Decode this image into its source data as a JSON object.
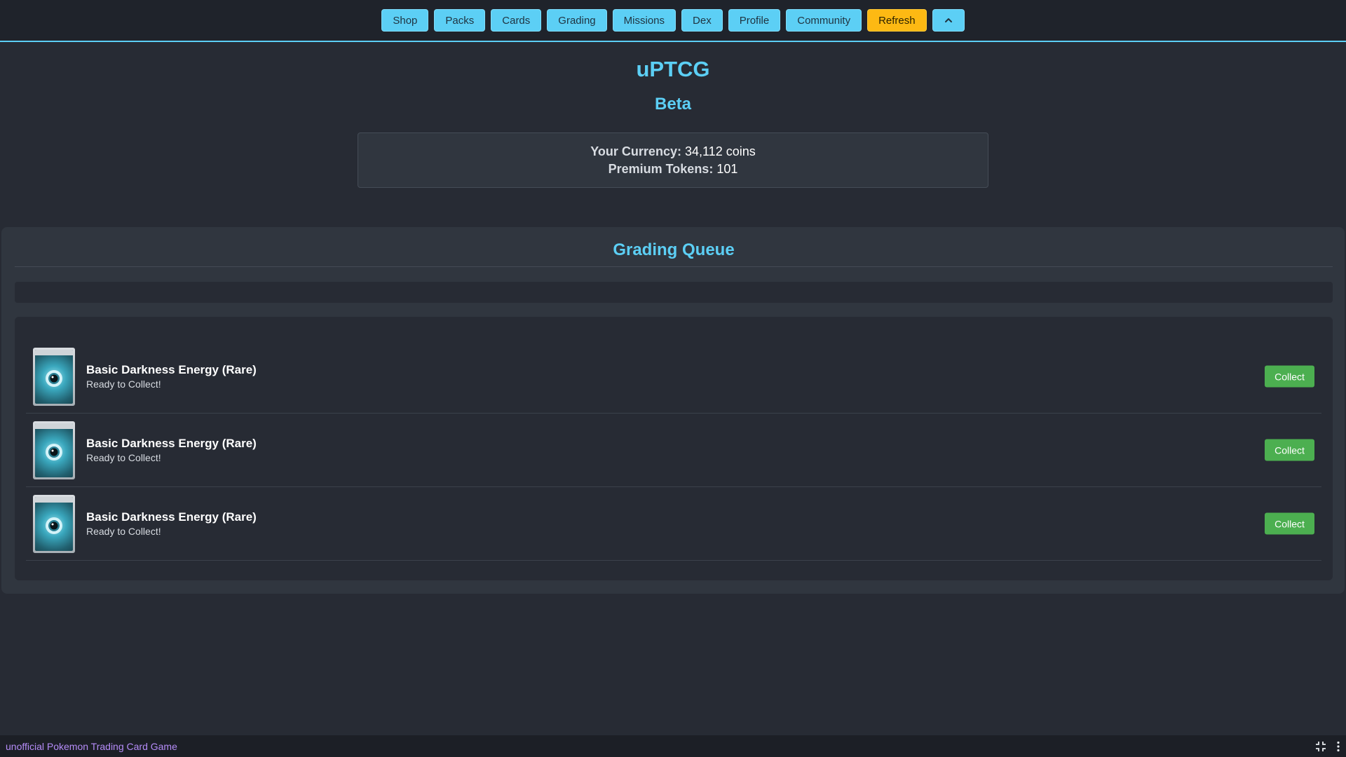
{
  "nav": {
    "items": [
      "Shop",
      "Packs",
      "Cards",
      "Grading",
      "Missions",
      "Dex",
      "Profile",
      "Community"
    ],
    "refresh_label": "Refresh",
    "collapse_icon": "chevron-up-icon"
  },
  "header": {
    "title": "uPTCG",
    "subtitle": "Beta"
  },
  "currency": {
    "coins_label": "Your Currency:",
    "coins_value": "34,112 coins",
    "tokens_label": "Premium Tokens:",
    "tokens_value": "101"
  },
  "grading_queue": {
    "title": "Grading Queue",
    "items": [
      {
        "name": "Basic Darkness Energy (Rare)",
        "status": "Ready to Collect!",
        "button": "Collect"
      },
      {
        "name": "Basic Darkness Energy (Rare)",
        "status": "Ready to Collect!",
        "button": "Collect"
      },
      {
        "name": "Basic Darkness Energy (Rare)",
        "status": "Ready to Collect!",
        "button": "Collect"
      }
    ]
  },
  "footer": {
    "text": "unofficial Pokemon Trading Card Game",
    "icons": [
      "exit-fullscreen-icon",
      "more-vertical-icon"
    ]
  },
  "colors": {
    "accent": "#5ccff5",
    "refresh": "#fdb913",
    "collect": "#4caf50",
    "background": "#272b34",
    "footer_text": "#b58cf8"
  }
}
